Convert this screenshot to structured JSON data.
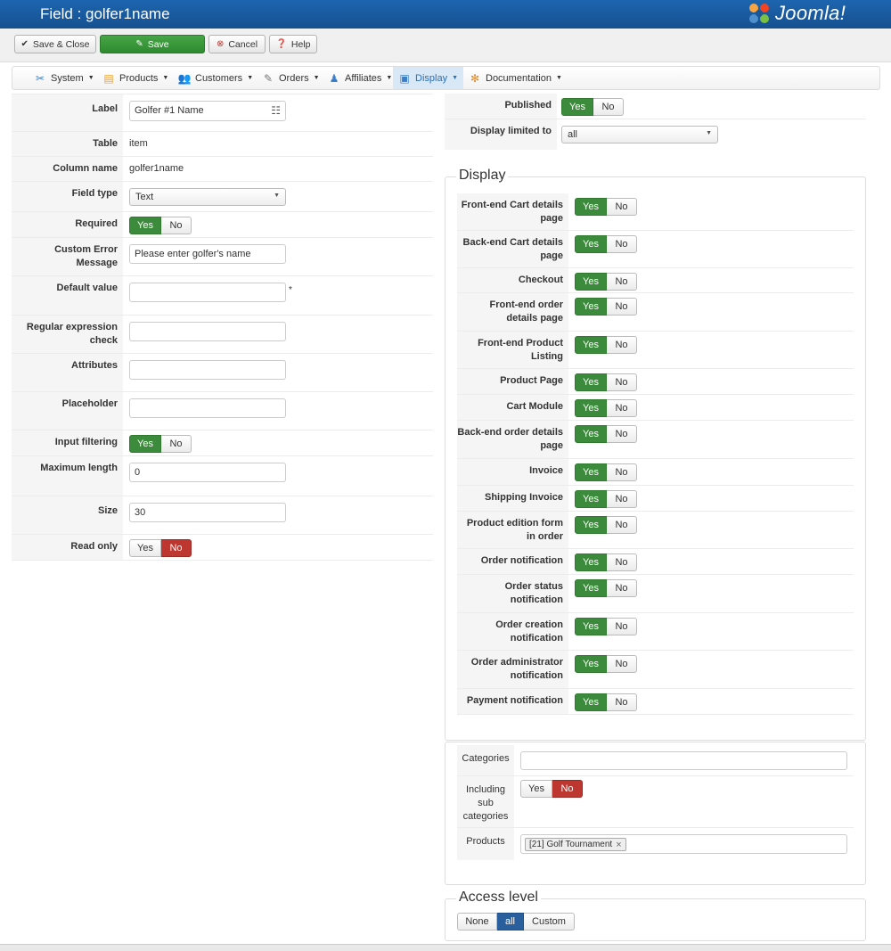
{
  "header": {
    "title": "Field : golfer1name",
    "logo_text": "Joomla!"
  },
  "toolbar": {
    "save_close": "Save & Close",
    "save": "Save",
    "cancel": "Cancel",
    "help": "Help"
  },
  "menu": [
    {
      "label": "System",
      "icon": "tools-icon"
    },
    {
      "label": "Products",
      "icon": "products-icon"
    },
    {
      "label": "Customers",
      "icon": "customers-icon"
    },
    {
      "label": "Orders",
      "icon": "orders-icon"
    },
    {
      "label": "Affiliates",
      "icon": "affiliates-icon"
    },
    {
      "label": "Display",
      "icon": "display-icon",
      "active": true
    },
    {
      "label": "Documentation",
      "icon": "documentation-icon"
    }
  ],
  "left": {
    "label": {
      "label": "Label",
      "value": "Golfer #1 Name"
    },
    "table": {
      "label": "Table",
      "value": "item"
    },
    "column": {
      "label": "Column name",
      "value": "golfer1name"
    },
    "field_type": {
      "label": "Field type",
      "value": "Text"
    },
    "required": {
      "label": "Required",
      "yes": "Yes",
      "no": "No",
      "selected": "yes"
    },
    "custom_error": {
      "label": "Custom Error Message",
      "value": "Please enter golfer's name"
    },
    "default_value": {
      "label": "Default value",
      "value": "",
      "asterisk": "*"
    },
    "regex": {
      "label": "Regular expression check",
      "value": ""
    },
    "attributes": {
      "label": "Attributes",
      "value": ""
    },
    "placeholder": {
      "label": "Placeholder",
      "value": ""
    },
    "input_filtering": {
      "label": "Input filtering",
      "yes": "Yes",
      "no": "No",
      "selected": "yes"
    },
    "max_length": {
      "label": "Maximum length",
      "value": "0"
    },
    "size": {
      "label": "Size",
      "value": "30"
    },
    "read_only": {
      "label": "Read only",
      "yes": "Yes",
      "no": "No",
      "selected": "no"
    }
  },
  "right": {
    "published": {
      "label": "Published",
      "yes": "Yes",
      "no": "No",
      "selected": "yes"
    },
    "display_limited": {
      "label": "Display limited to",
      "value": "all"
    },
    "display_legend": "Display",
    "display_rows": [
      {
        "label": "Front-end Cart details page",
        "selected": "yes"
      },
      {
        "label": "Back-end Cart details page",
        "selected": "yes"
      },
      {
        "label": "Checkout",
        "selected": "yes"
      },
      {
        "label": "Front-end order details page",
        "selected": "yes"
      },
      {
        "label": "Front-end Product Listing",
        "selected": "yes"
      },
      {
        "label": "Product Page",
        "selected": "yes"
      },
      {
        "label": "Cart Module",
        "selected": "yes"
      },
      {
        "label": "Back-end order details page",
        "selected": "yes"
      },
      {
        "label": "Invoice",
        "selected": "yes"
      },
      {
        "label": "Shipping Invoice",
        "selected": "yes"
      },
      {
        "label": "Product edition form in order",
        "selected": "yes"
      },
      {
        "label": "Order notification",
        "selected": "yes"
      },
      {
        "label": "Order status notification",
        "selected": "yes"
      },
      {
        "label": "Order creation notification",
        "selected": "yes"
      },
      {
        "label": "Order administrator notification",
        "selected": "yes"
      },
      {
        "label": "Payment notification",
        "selected": "yes"
      }
    ],
    "yes": "Yes",
    "no": "No",
    "categories": {
      "label": "Categories",
      "value": ""
    },
    "including_sub": {
      "label": "Including sub categories",
      "yes": "Yes",
      "no": "No",
      "selected": "no"
    },
    "products": {
      "label": "Products",
      "tag": "[21] Golf Tournament",
      "remove": "×"
    },
    "access_legend": "Access level",
    "access": {
      "none": "None",
      "all": "all",
      "custom": "Custom",
      "selected": "all"
    }
  }
}
